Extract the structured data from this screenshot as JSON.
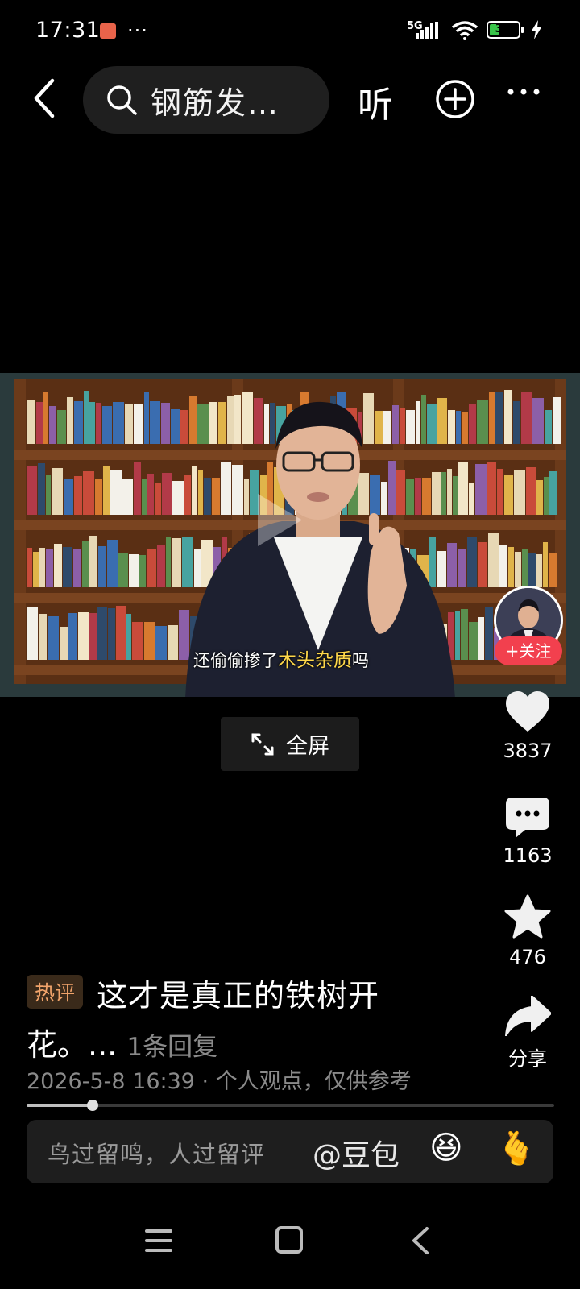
{
  "status_bar": {
    "time": "17:31",
    "more": "···",
    "network": "5G",
    "battery": "33",
    "battery_level": 0.33,
    "colors": {
      "battery_fill": "#39c54a",
      "notification": "#e8634a"
    },
    "icons": [
      "notification-icon",
      "signal-icon",
      "wifi-icon",
      "battery-icon",
      "charging-icon"
    ]
  },
  "top_bar": {
    "search_text": "钢筋发…",
    "listen_label": "听",
    "icons": [
      "back-icon",
      "search-icon",
      "add-circle-icon",
      "more-icon"
    ]
  },
  "video": {
    "subtitle_prefix": "还偷偷掺了",
    "subtitle_highlight": "木头杂质",
    "subtitle_suffix": "吗",
    "subtitle_highlight_color": "#ffd84a",
    "follow_label": "+关注",
    "follow_color": "#f2404e",
    "fullscreen_label": "全屏"
  },
  "actions": {
    "likes": "3837",
    "comments": "1163",
    "favorites": "476",
    "share_label": "分享",
    "icons": [
      "heart-icon",
      "comment-icon",
      "star-icon",
      "share-icon"
    ]
  },
  "comment": {
    "tag": "热评",
    "text_line1": "这才是真正的铁树开",
    "text_line2": "花。...",
    "reply_count": "1条回复",
    "meta": "2026-5-8 16:39 · 个人观点，仅供参考",
    "tag_color": "#f0a36a"
  },
  "progress": {
    "fraction": 0.125
  },
  "input": {
    "placeholder": "鸟过留鸣，人过留评",
    "mention": "@豆包",
    "emoji1": "😆",
    "emoji2": "🫰"
  },
  "nav": {
    "icons": [
      "menu-icon",
      "home-icon",
      "back-nav-icon"
    ]
  }
}
